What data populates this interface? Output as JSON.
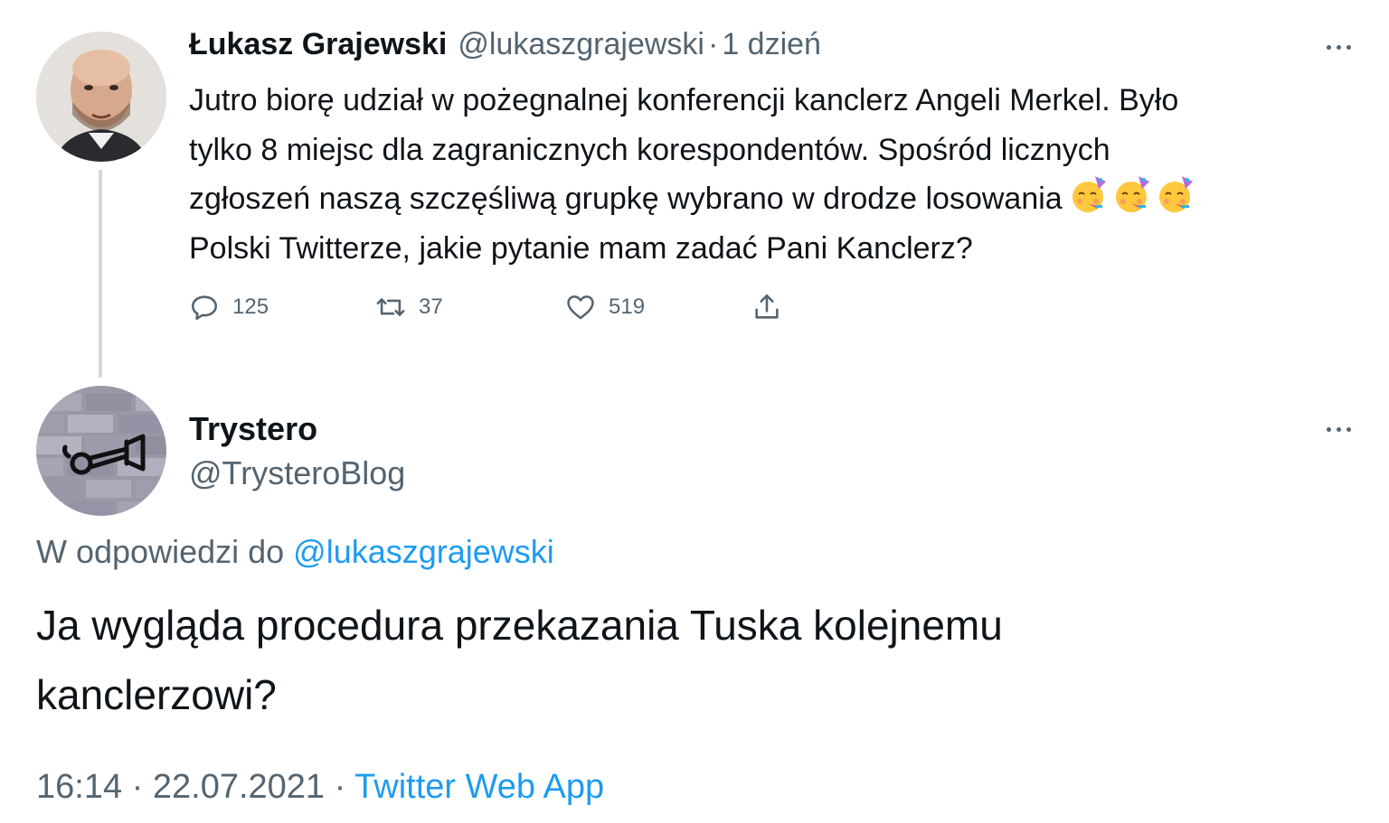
{
  "original_tweet": {
    "author_name": "Łukasz Grajewski",
    "author_handle": "@lukaszgrajewski",
    "separator": "·",
    "time_ago": "1 dzień",
    "text": "Jutro biorę udział w pożegnalnej konferencji kanclerz Angeli Merkel. Było\ntylko 8 miejsc dla zagranicznych korespondentów. Spośród licznych\nzgłoszeń naszą szczęśliwą grupkę wybrano w drodze losowania",
    "text_after_emoji": "Polski Twitterze, jakie pytanie mam zadać Pani Kanclerz?",
    "emojis": [
      "partying-face-emoji",
      "partying-face-emoji",
      "partying-face-emoji"
    ],
    "stats": {
      "replies": "125",
      "retweets": "37",
      "likes": "519"
    }
  },
  "reply_tweet": {
    "author_name": "Trystero",
    "author_handle": "@TrysteroBlog",
    "reply_prefix": "W odpowiedzi do",
    "reply_mention": "@lukaszgrajewski",
    "text": "Ja wygląda procedura przekazania Tuska kolejnemu\nkanclerzowi?",
    "time": "16:14",
    "date": "22.07.2021",
    "separator": "·",
    "source_app": "Twitter Web App"
  },
  "colors": {
    "text_primary": "#0f1419",
    "text_secondary": "#536471",
    "link": "#1d9bf0",
    "thread_line": "#cfd9de"
  }
}
